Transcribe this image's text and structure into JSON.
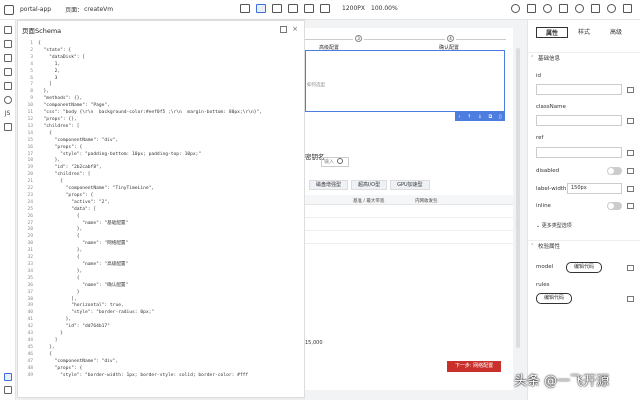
{
  "topbar": {
    "app_name": "portal-app",
    "page_label": "页面：",
    "page_name": "createVm",
    "width_label": "1200PX",
    "zoom": "100.00%"
  },
  "rail": {
    "js_label": "JS"
  },
  "schema": {
    "title": "页面Schema",
    "close": "×",
    "lines": [
      "{",
      "  \"state\": {",
      "    \"dataDisk\": [",
      "      1,",
      "      2,",
      "      3",
      "    ]",
      "  },",
      "  \"methods\": {},",
      "  \"componentName\": \"Page\",",
      "  \"css\": \"body {\\r\\n  background-color:#eef0f5 ;\\r\\n  margin-bottom: 80px;\\r\\n}\",",
      "  \"props\": {},",
      "  \"children\": [",
      "    {",
      "      \"componentName\": \"div\",",
      "      \"props\": {",
      "        \"style\": \"padding-bottom: 10px; padding-top: 10px;\"",
      "      },",
      "      \"id\": \"2b2cabf8\",",
      "      \"children\": [",
      "        {",
      "          \"componentName\": \"TinyTimeLine\",",
      "          \"props\": {",
      "            \"active\": \"2\",",
      "            \"data\": [",
      "              {",
      "                \"name\": \"基础配置\"",
      "              },",
      "              {",
      "                \"name\": \"网络配置\"",
      "              },",
      "              {",
      "                \"name\": \"高级配置\"",
      "              },",
      "              {",
      "                \"name\": \"确认配置\"",
      "              }",
      "            ],",
      "            \"horizontal\": true,",
      "            \"style\": \"border-radius: 0px;\"",
      "          },",
      "          \"id\": \"dd764b17\"",
      "        }",
      "      ]",
      "    },",
      "    {",
      "      \"componentName\": \"div\",",
      "      \"props\": {",
      "        \"style\": \"border-width: 1px; border-style: solid; border-color: #fff"
    ]
  },
  "canvas": {
    "steps": [
      {
        "num": "3",
        "label": "高级配置"
      },
      {
        "num": "4",
        "label": "确认配置"
      }
    ],
    "note": "如何选型",
    "form_label": "密钥名",
    "form_input": "输入",
    "tabs": [
      "磁盘增强型",
      "超高I/O型",
      "GPU加速型"
    ],
    "table_headers": [
      "基准 / 最大带宽",
      "内网收发包"
    ],
    "price": "15,000",
    "next_button": "下一步: 网络配置"
  },
  "props": {
    "tabs": [
      "属性",
      "样式",
      "高级"
    ],
    "section_basic": "基础信息",
    "fields": {
      "id": "id",
      "className": "className",
      "ref": "ref",
      "disabled": "disabled",
      "label_width": "label-width",
      "label_width_value": "150px",
      "inline": "inline"
    },
    "more": "更多类型选项",
    "section_validate": "校验属性",
    "model": "model",
    "rules": "rules",
    "edit_code": "编辑代码"
  },
  "watermark": "头条 @一飞开源"
}
